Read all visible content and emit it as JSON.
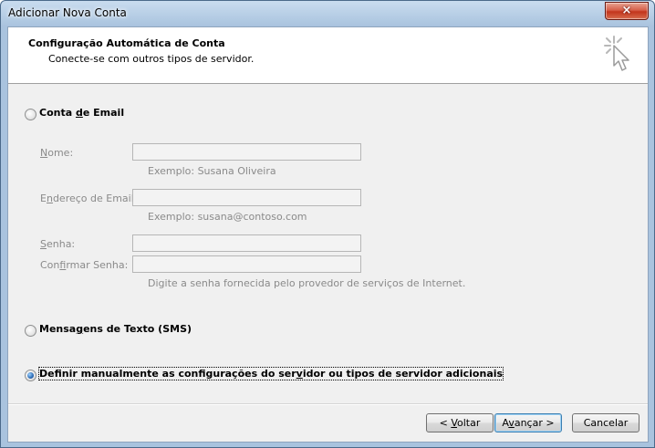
{
  "window": {
    "title": "Adicionar Nova Conta",
    "close_glyph": "×",
    "close_icon": "close-icon"
  },
  "header": {
    "title": "Configuração Automática de Conta",
    "subtitle": "Conecte-se com outros tipos de servidor.",
    "icon": "cursor-click-icon"
  },
  "options": {
    "email_account": {
      "label_pre": "Conta ",
      "label_u": "d",
      "label_post": "e Email",
      "selected": false
    },
    "sms": {
      "label_pre": "Mensa",
      "label_u": "g",
      "label_post": "ens de Texto (SMS)",
      "selected": false
    },
    "manual": {
      "label_pre": "Definir manualmente as configurações do ser",
      "label_u": "v",
      "label_post": "idor ou tipos de servidor adicionais",
      "selected": true
    }
  },
  "fields": {
    "name": {
      "label_u": "N",
      "label_rest": "ome:",
      "value": "",
      "hint": "Exemplo: Susana Oliveira"
    },
    "email": {
      "label_pre": "E",
      "label_u": "n",
      "label_post": "dereço de Email:",
      "value": "",
      "hint": "Exemplo: susana@contoso.com"
    },
    "password": {
      "label_u": "S",
      "label_rest": "enha:",
      "value": ""
    },
    "confirm": {
      "label_pre": "Con",
      "label_u": "f",
      "label_post": "irmar Senha:",
      "value": "",
      "hint": "Digite a senha fornecida pelo provedor de serviços de Internet."
    }
  },
  "buttons": {
    "back": {
      "pre": "< ",
      "u": "V",
      "post": "oltar"
    },
    "next": {
      "pre": "A",
      "u": "v",
      "post": "ançar >"
    },
    "cancel": {
      "label": "Cancelar"
    }
  }
}
